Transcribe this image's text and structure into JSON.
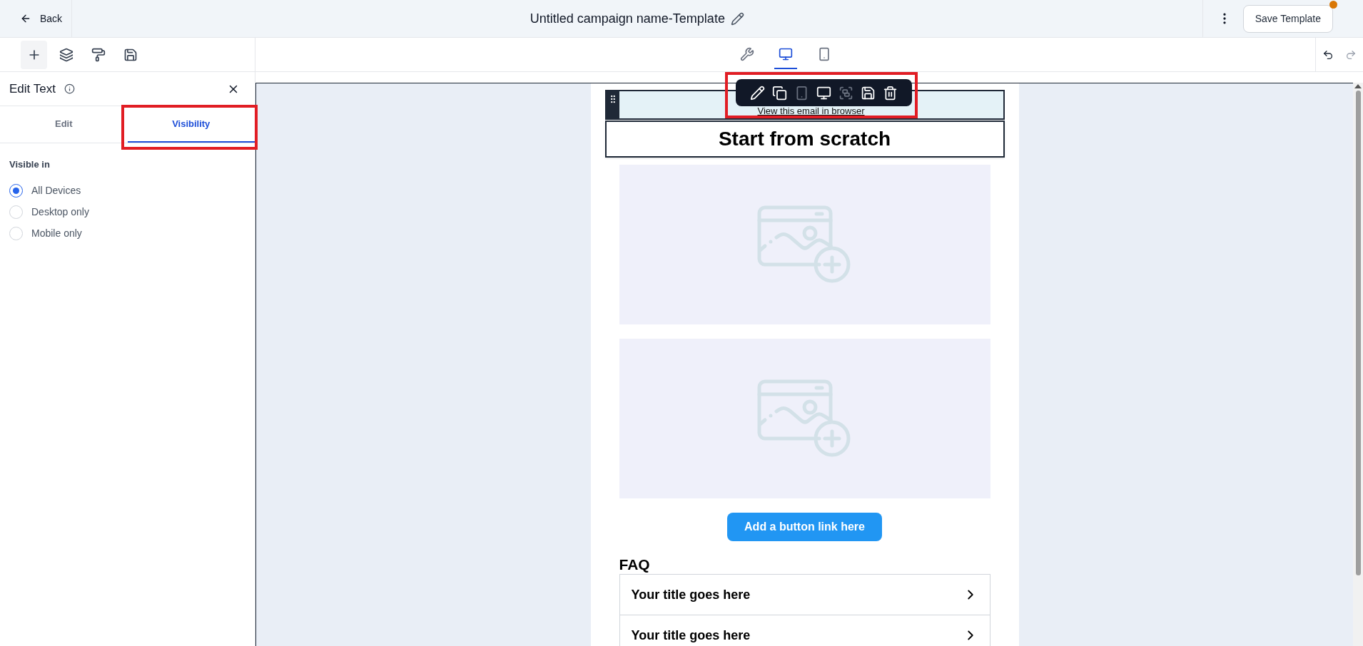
{
  "header": {
    "back": "Back",
    "title": "Untitled campaign name-Template",
    "save_button": "Save Template",
    "unsaved": true
  },
  "tools": [
    {
      "kind": "add",
      "selected": true
    },
    {
      "kind": "layers",
      "selected": false
    },
    {
      "kind": "style",
      "selected": false
    },
    {
      "kind": "save",
      "selected": false
    }
  ],
  "view_modes": [
    {
      "kind": "tools",
      "selected": false
    },
    {
      "kind": "desktop",
      "selected": true
    },
    {
      "kind": "mobile",
      "selected": false
    }
  ],
  "history": [
    {
      "kind": "undo",
      "disabled": false
    },
    {
      "kind": "redo",
      "disabled": true
    }
  ],
  "panel": {
    "title": "Edit Text",
    "tabs": [
      {
        "label": "Edit",
        "selected": false
      },
      {
        "label": "Visibility",
        "selected": true
      }
    ],
    "section_label": "Visible in",
    "options": [
      {
        "label": "All Devices",
        "selected": true
      },
      {
        "label": "Desktop only",
        "selected": false
      },
      {
        "label": "Mobile only",
        "selected": false
      }
    ]
  },
  "block_toolbar": [
    {
      "kind": "edit",
      "disabled": false
    },
    {
      "kind": "duplicate",
      "disabled": false
    },
    {
      "kind": "mobile",
      "disabled": true
    },
    {
      "kind": "desktop",
      "disabled": false
    },
    {
      "kind": "group",
      "disabled": true
    },
    {
      "kind": "save",
      "disabled": false
    },
    {
      "kind": "delete",
      "disabled": false
    }
  ],
  "email": {
    "browser_link": "View this email in browser",
    "heading": "Start from scratch",
    "images": [
      {
        "kind": "image_placeholder"
      },
      {
        "kind": "image_placeholder"
      }
    ],
    "button": "Add a button link here",
    "faq_title": "FAQ",
    "faq_items": [
      "Your title goes here",
      "Your title goes here"
    ]
  }
}
